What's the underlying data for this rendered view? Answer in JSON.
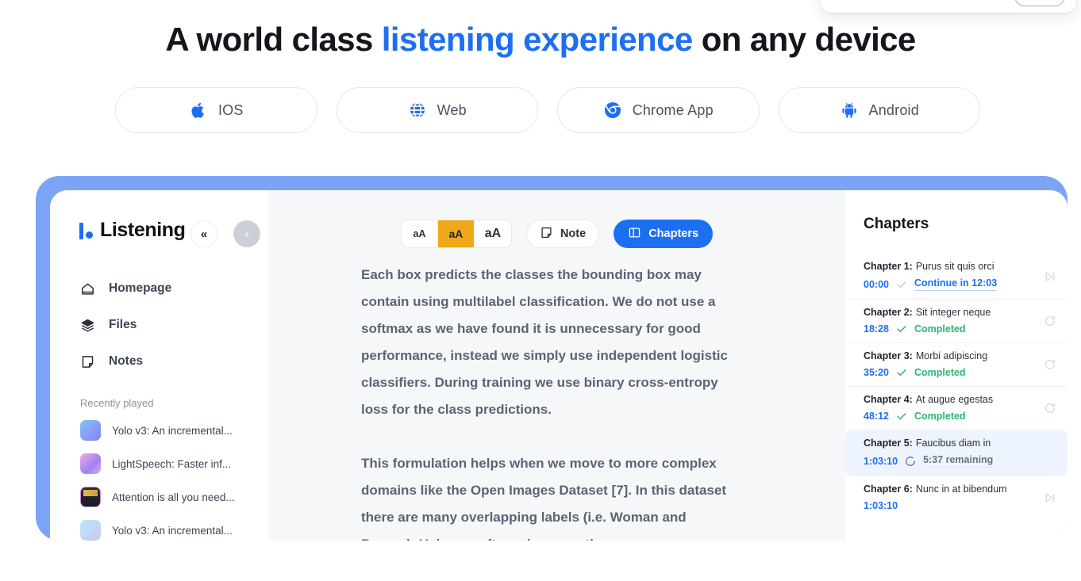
{
  "headline": {
    "before": "A world class ",
    "highlight": "listening experience",
    "after": " on any device",
    "highlight_color": "#1d6ff2"
  },
  "platforms": [
    {
      "label": "IOS",
      "icon": "apple-icon"
    },
    {
      "label": "Web",
      "icon": "globe-icon"
    },
    {
      "label": "Chrome App",
      "icon": "chrome-icon"
    },
    {
      "label": "Android",
      "icon": "android-icon"
    }
  ],
  "app": {
    "brand": "Listening",
    "sidebar": {
      "nav": [
        {
          "label": "Homepage",
          "icon": "home-icon"
        },
        {
          "label": "Files",
          "icon": "layers-icon"
        },
        {
          "label": "Notes",
          "icon": "note-icon"
        }
      ],
      "recent_title": "Recently played",
      "recent": [
        {
          "label": "Yolo v3: An incremental..."
        },
        {
          "label": "LightSpeech: Faster inf..."
        },
        {
          "label": "Attention is all you need..."
        },
        {
          "label": "Yolo v3: An incremental..."
        }
      ]
    },
    "toolbar": {
      "font_small": "aA",
      "font_medium": "aA",
      "font_large": "aA",
      "active_font": "aA",
      "note_label": "Note",
      "chapters_label": "Chapters",
      "accent_color": "#1d6ff2",
      "active_font_bg": "#f0a81b"
    },
    "reader": {
      "paragraphs": [
        "Each box predicts the classes the bounding box may contain using multilabel classification. We do not use a softmax as we have found it is unnecessary for good performance, instead we simply use independent logistic classifiers. During training we use binary cross-entropy loss for the class predictions.",
        "This formulation helps when we move to more complex domains like the Open Images Dataset [7]. In this dataset there are many overlapping labels (i.e. Woman and Person). Using a softmax imposes the"
      ]
    },
    "chapters": {
      "title": "Chapters",
      "items": [
        {
          "label": "Chapter 1:",
          "name": "Purus sit quis orci",
          "time": "00:00",
          "status": "Continue in 12:03",
          "status_type": "continue",
          "action_icon": "skip-next-icon",
          "active": false
        },
        {
          "label": "Chapter 2:",
          "name": "Sit integer neque",
          "time": "18:28",
          "status": "Completed",
          "status_type": "completed",
          "action_icon": "replay-icon",
          "active": false
        },
        {
          "label": "Chapter 3:",
          "name": "Morbi adipiscing",
          "time": "35:20",
          "status": "Completed",
          "status_type": "completed",
          "action_icon": "replay-icon",
          "active": false
        },
        {
          "label": "Chapter 4:",
          "name": "At augue egestas",
          "time": "48:12",
          "status": "Completed",
          "status_type": "completed",
          "action_icon": "replay-icon",
          "active": false
        },
        {
          "label": "Chapter 5:",
          "name": "Faucibus diam in",
          "time": "1:03:10",
          "status": "5:37 remaining",
          "status_type": "remaining",
          "action_icon": "",
          "active": true
        },
        {
          "label": "Chapter 6:",
          "name": "Nunc in at bibendum",
          "time": "1:03:10",
          "status": "",
          "status_type": "none",
          "action_icon": "skip-next-icon",
          "active": false
        }
      ]
    }
  }
}
